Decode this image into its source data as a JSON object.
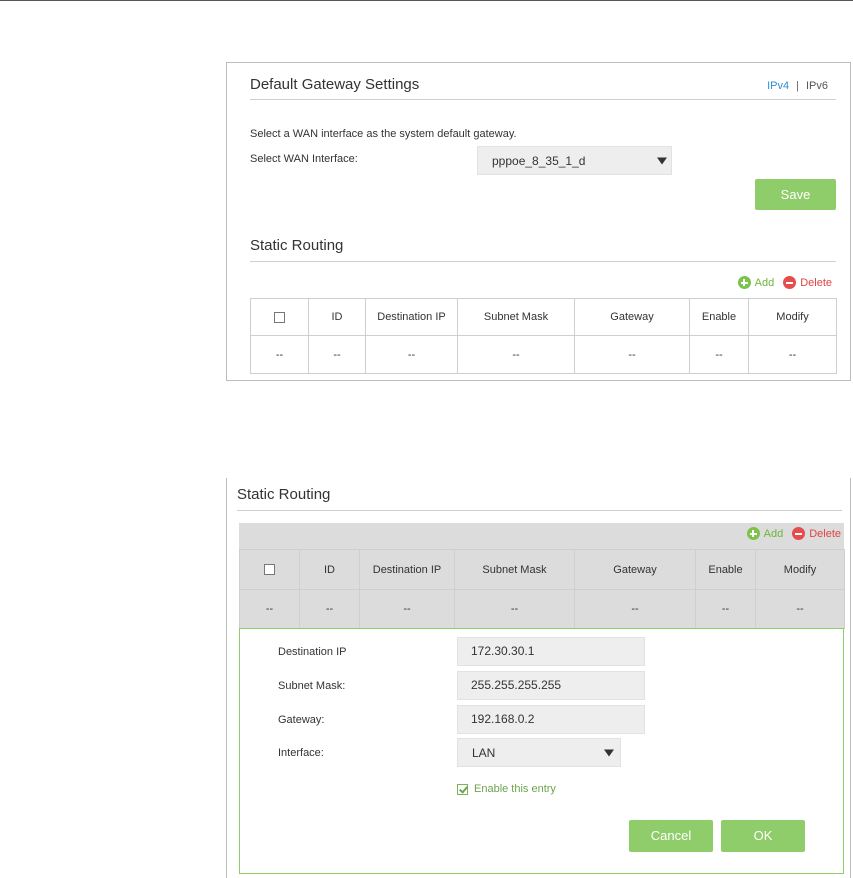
{
  "gateway": {
    "title": "Default Gateway Settings",
    "ipv4": "IPv4",
    "separator": "|",
    "ipv6": "IPv6",
    "description": "Select a WAN interface as the system default gateway.",
    "wan_label": "Select WAN Interface:",
    "wan_value": "pppoe_8_35_1_d",
    "save_label": "Save"
  },
  "routing": {
    "title": "Static Routing",
    "add_label": "Add",
    "delete_label": "Delete",
    "columns": [
      "ID",
      "Destination IP",
      "Subnet Mask",
      "Gateway",
      "Enable",
      "Modify"
    ],
    "empty_row": [
      "--",
      "--",
      "--",
      "--",
      "--",
      "--",
      "--"
    ]
  },
  "edit": {
    "title": "Static Routing",
    "add_label": "Add",
    "delete_label": "Delete",
    "columns": [
      "ID",
      "Destination IP",
      "Subnet Mask",
      "Gateway",
      "Enable",
      "Modify"
    ],
    "empty_row": [
      "--",
      "--",
      "--",
      "--",
      "--",
      "--",
      "--"
    ],
    "form": {
      "dest_label": "Destination IP",
      "dest_value": "172.30.30.1",
      "mask_label": "Subnet Mask:",
      "mask_value": "255.255.255.255",
      "gateway_label": "Gateway:",
      "gateway_value": "192.168.0.2",
      "interface_label": "Interface:",
      "interface_value": "LAN",
      "enable_label": "Enable this entry",
      "enable_checked": true,
      "cancel_label": "Cancel",
      "ok_label": "OK"
    }
  },
  "colors": {
    "accent_green": "#8fcd6a",
    "link_blue": "#2d8fd5",
    "delete_red": "#e64c4c"
  }
}
